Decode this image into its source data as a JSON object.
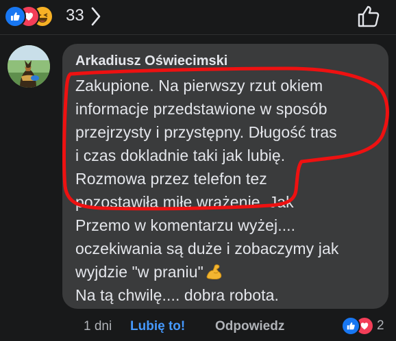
{
  "top_reactions": {
    "count": "33"
  },
  "comment": {
    "author": "Arkadiusz Oświecimski",
    "lines": [
      "Zakupione. Na pierwszy rzut okiem",
      "informacje przedstawione w sposób",
      "przejrzysty i przystępny. Długość tras",
      "i czas dokladnie taki jak lubię.",
      "Rozmowa przez telefon tez",
      "pozostawiła miłe wrażenie. Jak",
      "Przemo w komentarzu wyżej....",
      "oczekiwania są duże i zobaczymy jak",
      "wyjdzie \"w praniu\"",
      "Na tą chwilę.... dobra robota."
    ],
    "time": "1 dni",
    "like_label": "Lubię to!",
    "reply_label": "Odpowiedz",
    "reaction_count": "2"
  },
  "icons": {
    "like": "like-reaction-icon",
    "love": "love-reaction-icon",
    "haha": "haha-reaction-icon",
    "chevron": "chevron-right-icon",
    "thumbs_up_outline": "thumbs-up-outline-icon",
    "flexed_biceps": "flexed-biceps-emoji"
  },
  "colors": {
    "background": "#18191a",
    "bubble": "#3a3b3c",
    "text": "#e4e6eb",
    "secondary_text": "#b0b3b8",
    "link_blue": "#4599ff",
    "like_blue": "#1877f2",
    "love_red": "#f33e58",
    "haha_yellow": "#f7b125",
    "annotation_red": "#ee1111"
  }
}
